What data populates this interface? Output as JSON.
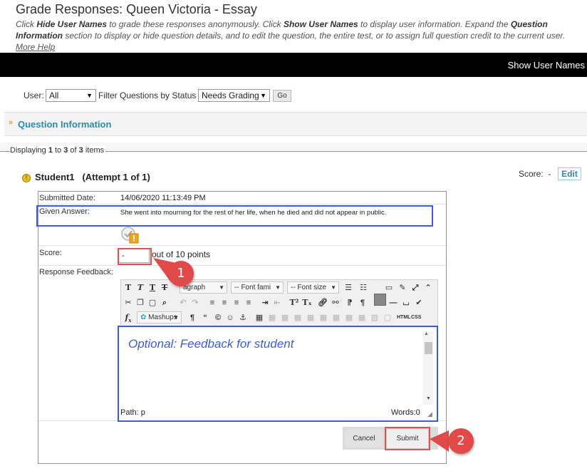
{
  "header": {
    "title": "Grade Responses: Queen Victoria - Essay",
    "instr_1": "Click ",
    "instr_hide": "Hide User Names",
    "instr_2": " to grade these responses anonymously. Click ",
    "instr_show": "Show User Names",
    "instr_3": " to display user information. Expand the ",
    "instr_qi": "Question Information",
    "instr_4": " section to display or hide question details, and to edit the question, the entire test, or to assign full question credit to the current user. ",
    "more_help": "More Help"
  },
  "action_bar": {
    "show_user_names": "Show User Names"
  },
  "filters": {
    "user_label": "User:",
    "user_value": "All",
    "status_label": "Filter Questions by Status",
    "status_value": "Needs Grading",
    "go_label": "Go"
  },
  "question_info": {
    "label": "Question Information"
  },
  "pagination": {
    "prefix": "Displaying ",
    "from": "1",
    "to_word": " to ",
    "to": "3",
    "of_word": " of ",
    "total": "3",
    "suffix": " items"
  },
  "student": {
    "name": "Student1",
    "attempt": "(Attempt 1 of 1)",
    "score_label": "Score:",
    "score_value": "-",
    "edit_label": "Edit"
  },
  "response": {
    "submitted_label": "Submitted Date:",
    "submitted_value": "14/06/2020 11:13:49 PM",
    "answer_label": "Given Answer:",
    "answer_value": "She went into mourning for the rest of her life, when he died and did not appear in public.",
    "score_label": "Score:",
    "score_input_value": "-",
    "out_of": "out of 10 points",
    "feedback_label": "Response Feedback:"
  },
  "editor": {
    "paragraph": "agraph",
    "font_family": "-- Font fami",
    "font_size": "-- Font size",
    "mashups": "Mashups",
    "html_label": "HTML",
    "css_label": "CSS",
    "placeholder": "Optional: Feedback for student",
    "path": "Path: p",
    "words": "Words:0"
  },
  "buttons": {
    "cancel": "Cancel",
    "submit": "Submit"
  },
  "callouts": {
    "one": "1",
    "two": "2"
  },
  "colors": {
    "accent_blue": "#2d8ab0",
    "highlight_blue": "#3e5bdc",
    "highlight_red": "#e05151",
    "callout_red": "#e24a4a"
  }
}
